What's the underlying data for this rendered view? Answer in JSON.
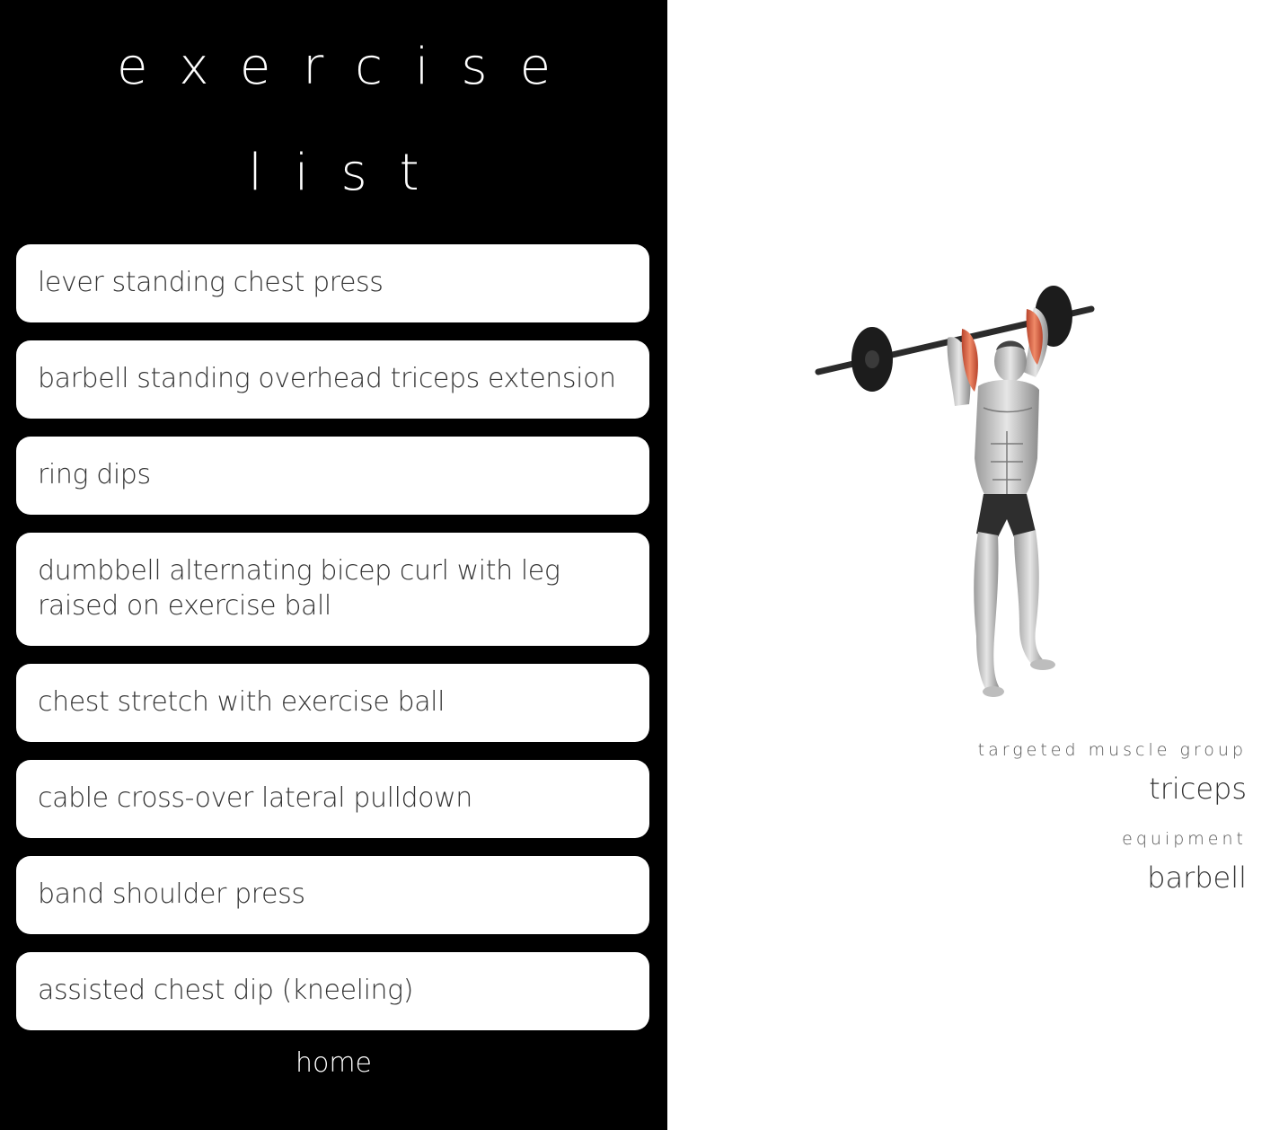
{
  "title": {
    "line1": "exercise",
    "line2": "list"
  },
  "exercises": [
    "lever standing chest press",
    "barbell standing overhead triceps extension",
    "ring dips",
    "dumbbell alternating bicep curl with leg raised on exercise ball",
    "chest stretch with exercise ball",
    "cable cross-over lateral pulldown",
    "band shoulder press",
    "assisted chest dip (kneeling)"
  ],
  "nav": {
    "home_label": "home"
  },
  "detail": {
    "muscle_caption": "targeted muscle group",
    "muscle_value": "triceps",
    "equipment_caption": "equipment",
    "equipment_value": "barbell"
  },
  "colors": {
    "panel_background": "#000000",
    "card_background": "#ffffff",
    "highlight_muscle": "#d9573a"
  },
  "figure": {
    "icon": "barbell-overhead-triceps-extension-illustration"
  }
}
